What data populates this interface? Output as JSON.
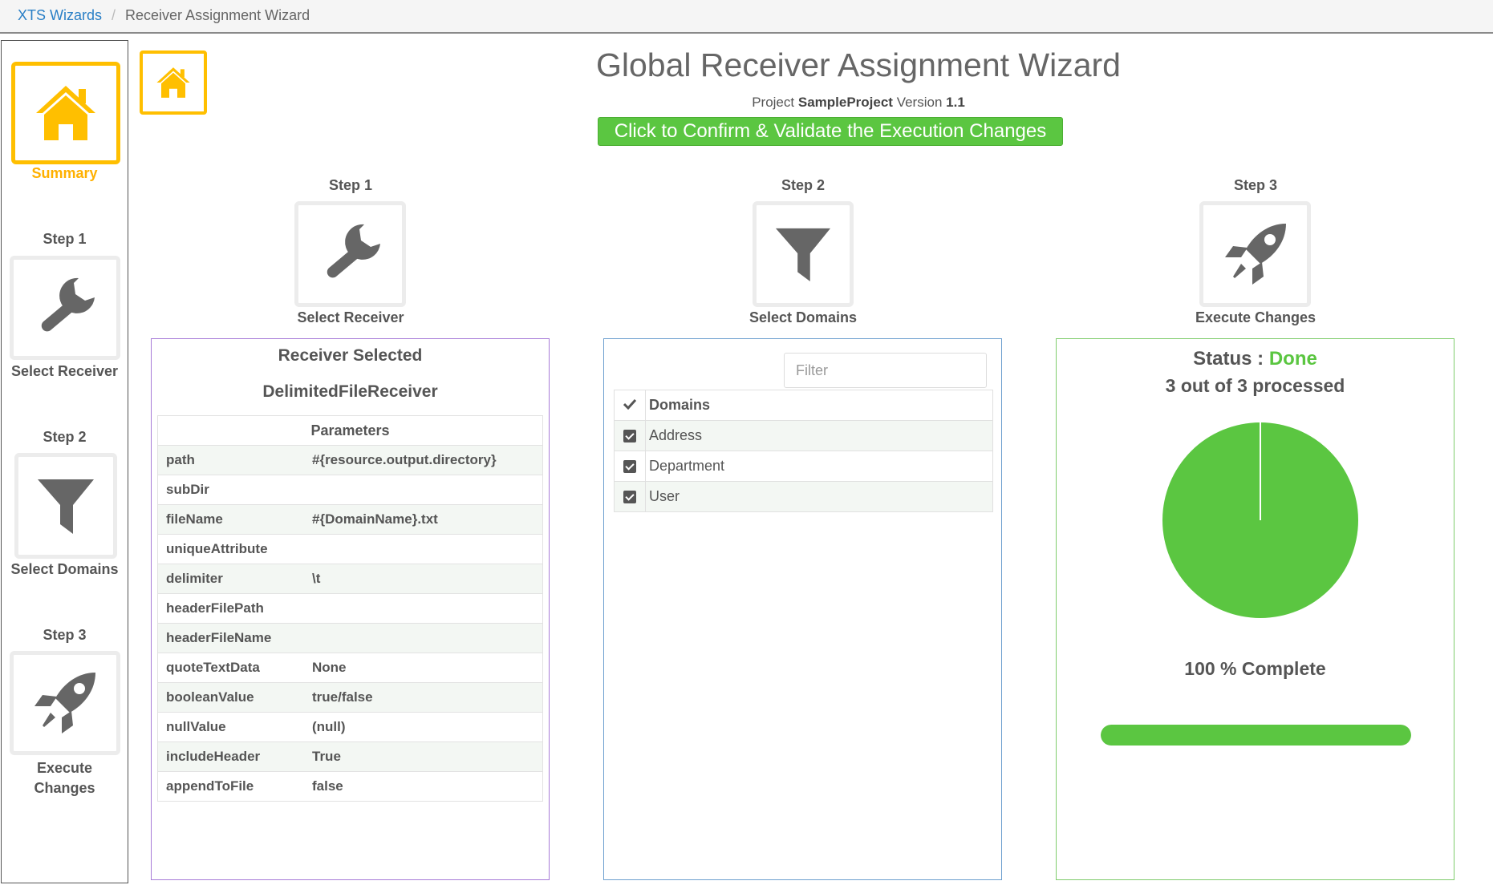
{
  "breadcrumb": {
    "root": "XTS Wizards",
    "separator": "/",
    "current": "Receiver Assignment Wizard"
  },
  "sidebar": {
    "summary_label": "Summary",
    "step1": {
      "title": "Step 1",
      "label": "Select Receiver"
    },
    "step2": {
      "title": "Step 2",
      "label": "Select Domains"
    },
    "step3": {
      "title": "Step 3",
      "label_line1": "Execute",
      "label_line2": "Changes"
    }
  },
  "header": {
    "title": "Global Receiver Assignment Wizard",
    "project_prefix": "Project",
    "project_name": "SampleProject",
    "version_prefix": "Version",
    "version": "1.1",
    "confirm_button": "Click to Confirm & Validate the Execution Changes"
  },
  "steps": [
    {
      "title": "Step 1",
      "label": "Select Receiver",
      "icon": "wrench-icon"
    },
    {
      "title": "Step 2",
      "label": "Select Domains",
      "icon": "filter-icon"
    },
    {
      "title": "Step 3",
      "label": "Execute Changes",
      "icon": "rocket-icon"
    }
  ],
  "receiver": {
    "heading": "Receiver Selected",
    "name": "DelimitedFileReceiver",
    "params_header": "Parameters",
    "params": [
      {
        "key": "path",
        "value": "#{resource.output.directory}"
      },
      {
        "key": "subDir",
        "value": ""
      },
      {
        "key": "fileName",
        "value": "#{DomainName}.txt"
      },
      {
        "key": "uniqueAttribute",
        "value": ""
      },
      {
        "key": "delimiter",
        "value": "\\t"
      },
      {
        "key": "headerFilePath",
        "value": ""
      },
      {
        "key": "headerFileName",
        "value": ""
      },
      {
        "key": "quoteTextData",
        "value": "None"
      },
      {
        "key": "booleanValue",
        "value": "true/false"
      },
      {
        "key": "nullValue",
        "value": "(null)"
      },
      {
        "key": "includeHeader",
        "value": "True"
      },
      {
        "key": "appendToFile",
        "value": "false"
      }
    ]
  },
  "domains": {
    "filter_placeholder": "Filter",
    "header": "Domains",
    "items": [
      {
        "name": "Address",
        "checked": true
      },
      {
        "name": "Department",
        "checked": true
      },
      {
        "name": "User",
        "checked": true
      }
    ]
  },
  "status": {
    "label": "Status :",
    "value": "Done",
    "processed_text": "3 out of 3 processed",
    "complete_text": "100 % Complete",
    "progress_percent": 100,
    "colors": {
      "done": "#5bc641",
      "accent": "#ffbf00"
    }
  }
}
